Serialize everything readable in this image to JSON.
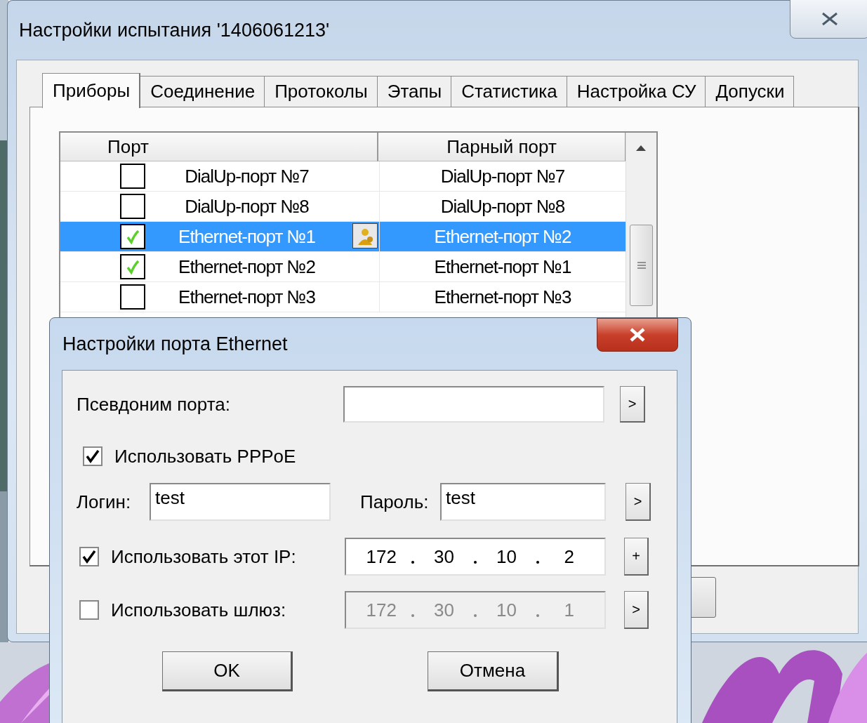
{
  "window": {
    "title": "Настройки испытания '1406061213'"
  },
  "tabs": [
    {
      "label": "Приборы",
      "selected": true
    },
    {
      "label": "Соединение",
      "selected": false
    },
    {
      "label": "Протоколы",
      "selected": false
    },
    {
      "label": "Этапы",
      "selected": false
    },
    {
      "label": "Статистика",
      "selected": false
    },
    {
      "label": "Настройка СУ",
      "selected": false
    },
    {
      "label": "Допуски",
      "selected": false
    }
  ],
  "table": {
    "columns": [
      "Порт",
      "Парный порт"
    ],
    "rows": [
      {
        "checked": false,
        "port": "DialUp-порт №7",
        "pair": "DialUp-порт №7",
        "selected": false,
        "has_button": false
      },
      {
        "checked": false,
        "port": "DialUp-порт №8",
        "pair": "DialUp-порт №8",
        "selected": false,
        "has_button": false
      },
      {
        "checked": true,
        "port": "Ethernet-порт №1",
        "pair": "Ethernet-порт №2",
        "selected": true,
        "has_button": true
      },
      {
        "checked": true,
        "port": "Ethernet-порт №2",
        "pair": "Ethernet-порт №1",
        "selected": false,
        "has_button": false
      },
      {
        "checked": false,
        "port": "Ethernet-порт №3",
        "pair": "Ethernet-порт №3",
        "selected": false,
        "has_button": false
      }
    ]
  },
  "dialog": {
    "title": "Настройки порта Ethernet",
    "alias": {
      "label": "Псевдоним порта:",
      "button": ">"
    },
    "pppoe": {
      "label": "Использовать PPPoE",
      "checked": true
    },
    "login": {
      "label": "Логин:",
      "value": "test"
    },
    "password": {
      "label": "Пароль:",
      "value": "test",
      "button": ">"
    },
    "ip_rows": [
      {
        "label": "Использовать этот IP:",
        "checked": true,
        "disabled": false,
        "octets": [
          "172",
          "30",
          "10",
          "2"
        ],
        "button": "+"
      },
      {
        "label": "Использовать шлюз:",
        "checked": false,
        "disabled": true,
        "octets": [
          "172",
          "30",
          "10",
          "1"
        ],
        "button": ">"
      }
    ],
    "buttons": [
      "OK",
      "Отмена"
    ]
  }
}
